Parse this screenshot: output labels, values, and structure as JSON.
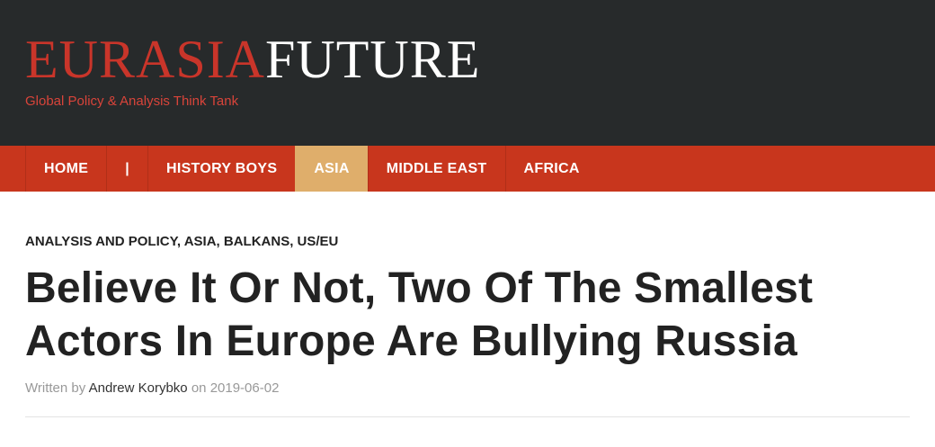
{
  "site": {
    "logo_part1": "EURASIA",
    "logo_part2": "FUTURE",
    "tagline": "Global Policy & Analysis Think Tank"
  },
  "nav": {
    "items": [
      {
        "label": "HOME"
      },
      {
        "label": "|"
      },
      {
        "label": "HISTORY BOYS"
      },
      {
        "label": "ASIA",
        "active": true
      },
      {
        "label": "MIDDLE EAST"
      },
      {
        "label": "AFRICA"
      }
    ]
  },
  "article": {
    "categories": "ANALYSIS AND POLICY, ASIA, BALKANS, US/EU",
    "title": "Believe It Or Not, Two Of The Smallest Actors In Europe Are Bullying Russia",
    "byline_prefix": "Written by",
    "author": "Andrew Korybko",
    "date_prefix": "on",
    "date": "2019-06-02"
  },
  "colors": {
    "header_bg": "#272a2b",
    "logo_red": "#c9352a",
    "nav_bg": "#c8361d",
    "nav_active": "#dfae6b"
  }
}
